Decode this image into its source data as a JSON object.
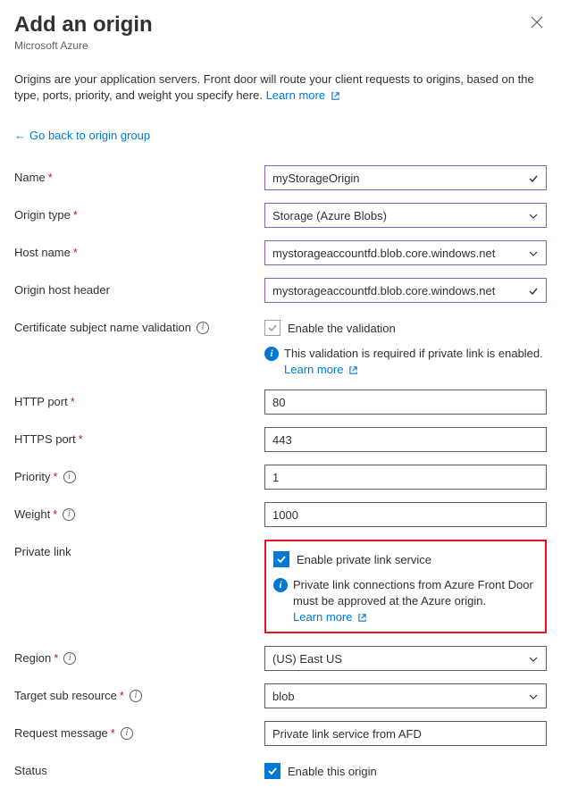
{
  "header": {
    "title": "Add an origin",
    "subtitle": "Microsoft Azure"
  },
  "description": {
    "text": "Origins are your application servers. Front door will route your client requests to origins, based on the type, ports, priority, and weight you specify here. ",
    "learn_more": "Learn more"
  },
  "back_link": "Go back to origin group",
  "fields": {
    "name": {
      "label": "Name",
      "value": "myStorageOrigin"
    },
    "origin_type": {
      "label": "Origin type",
      "value": "Storage (Azure Blobs)"
    },
    "host_name": {
      "label": "Host name",
      "value": "mystorageaccountfd.blob.core.windows.net"
    },
    "origin_host_header": {
      "label": "Origin host header",
      "value": "mystorageaccountfd.blob.core.windows.net"
    },
    "cert_validation": {
      "label": "Certificate subject name validation",
      "checkbox_label": "Enable the validation",
      "info_text": "This validation is required if private link is enabled. ",
      "learn_more": "Learn more"
    },
    "http_port": {
      "label": "HTTP port",
      "value": "80"
    },
    "https_port": {
      "label": "HTTPS port",
      "value": "443"
    },
    "priority": {
      "label": "Priority",
      "value": "1"
    },
    "weight": {
      "label": "Weight",
      "value": "1000"
    },
    "private_link": {
      "label": "Private link",
      "checkbox_label": "Enable private link service",
      "info_text": "Private link connections from Azure Front Door must be approved at the Azure origin.",
      "learn_more": "Learn more"
    },
    "region": {
      "label": "Region",
      "value": "(US) East US"
    },
    "target_sub_resource": {
      "label": "Target sub resource",
      "value": "blob"
    },
    "request_message": {
      "label": "Request message",
      "value": "Private link service from AFD"
    },
    "status": {
      "label": "Status",
      "checkbox_label": "Enable this origin"
    }
  }
}
